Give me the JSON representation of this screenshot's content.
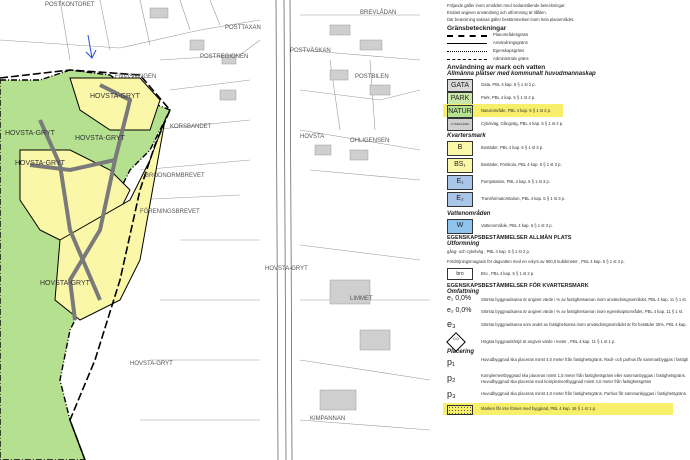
{
  "map": {
    "streets": [
      "POSTKONTORET",
      "POSTTAXAN",
      "BREVLÅDAN",
      "POSTVÄSKAN",
      "POSTREGIONEN",
      "POSTBILEN",
      "ENVISNINGEN",
      "KORSBANDET",
      "OHLIGENSEN",
      "BRÖDNORMBREVET",
      "FÖRENINGSBREVET",
      "HOVSTA-GRYT",
      "HOVSTA",
      "LIMMET",
      "KIMPANNAN",
      "HOVSTA-GRYT"
    ],
    "area_labels": [
      "HOVSTA-GRYT",
      "HOVSTA-GRYT",
      "HOVSTA-GRYT",
      "HOVSTA-GRYT",
      "HOVSTA-GRYT"
    ],
    "colors": {
      "natur": "#b5e08f",
      "bostad": "#fbf7a8",
      "gata": "#d9d9d9",
      "border": "#000000"
    }
  },
  "legend": {
    "intro": [
      "Följande gäller inom områden med nedanstående beteckningar.",
      "Endast angiven användning och utformning är tillåten.",
      "Där beteckning saknas gäller bestämmelsen inom hela planområdet."
    ],
    "boundaries_title": "Gränsbeteckningar",
    "boundaries": [
      "Planområdesgräns",
      "Användningsgräns",
      "Egenskapsgräns",
      "Administrativ gräns"
    ],
    "land_water_title": "Användning av mark och vatten",
    "public_title": "Allmänna platser med kommunalt huvudmannaskap",
    "public": [
      {
        "code": "GATA",
        "text": "Gata, PBL 4 kap. 5 § 1 st 2 p."
      },
      {
        "code": "PARK",
        "text": "Park, PBL 4 kap. 5 § 1 st 2 p."
      },
      {
        "code": "NATUR",
        "text": "Naturområde, PBL 4 kap. 5 § 1 st 2 p."
      },
      {
        "code": "CYKELGÅNG",
        "text": "Cykelväg, Gångväg, PBL 4 kap. 5 § 1 st 2 p."
      }
    ],
    "block_title": "Kvartersmark",
    "blocks": [
      {
        "code": "B",
        "text": "Bostäder, PBL 4 kap. 5 § 1 st 3 p."
      },
      {
        "code": "BS₁",
        "text": "Bostäder, Förskola, PBL 4 kap. 5 § 1 st 3 p."
      },
      {
        "code": "E₁",
        "text": "Pumpstation, PBL 4 kap. 5 § 1 st 3 p."
      },
      {
        "code": "E₂",
        "text": "Transformatorstation, PBL 4 kap. 5 § 1 st 3 p."
      }
    ],
    "water_title": "Vattenområden",
    "water": [
      {
        "code": "W",
        "text": "Vattenområde, PBL 4 kap. 5 § 1 st 3 p."
      }
    ],
    "props_public_title": "EGENSKAPSBESTÄMMELSER ALLMÄN PLATS",
    "design_title": "Utformning",
    "design": [
      {
        "code": "gång",
        "text": "gång- och cykelväg , PBL 4 kap. 5 § 1 st 2 p."
      },
      {
        "code": "fördröjning",
        "text": "Fördröjningsmagasin för dagvatten med en volym av 600,0 kubikmeter , PBL 4 kap. 5 § 1 st 2 p."
      },
      {
        "code": "bro",
        "text": "Bro , PBL 4 kap. 5 § 1 st 2 p."
      }
    ],
    "props_block_title": "EGENSKAPSBESTÄMMELSER FÖR KVARTERSMARK",
    "scope_title": "Omfattning",
    "scope": [
      {
        "code": "e₁ 0,0%",
        "text": "Största byggnadsarea är angivet värde i % av fastighetsarean inom användningsområdet, PBL 4 kap. 11 § 1 st."
      },
      {
        "code": "e₂ 0,0%",
        "text": "Största byggnadsarea är angivet värde i % av fastighetsarean inom egenskapsområdet, PBL 4 kap. 11 § 1 st."
      },
      {
        "code": "e₃",
        "text": "Största byggnadsarea som andel av fastighetsarea inom användningsområdet är för bostäder 25%, PBL 4 kap."
      },
      {
        "code": "0,0",
        "text": "Högsta byggnadshöjd är angivet värde i meter , PBL 4 kap. 11 § 1 st 1 p."
      }
    ],
    "placement_title": "Placering",
    "placement": [
      {
        "code": "p₁",
        "text": "Huvudbyggnad ska placeras minst 4,0 meter från fastighetsgräns. Radi- och parhus får sammanbyggas i fastigh"
      },
      {
        "code": "p₂",
        "text": "Komplementbyggnad ska placeras minst 1,5 meter från fastighetsgräns eller sammanbyggas i fastighetsgräns. Huvudbyggnad ska placeras med komplementbyggnad minst 4,0 meter från fastighetsgräns"
      },
      {
        "code": "p₃",
        "text": "Huvudbyggnad ska placeras minst 4,0 meter från fastighetsgräns. Parhus får sammanbyggas i fastighetsgräns."
      },
      {
        "code": "",
        "text": "Marken får inte förses med byggnad, PBL 4 kap. 16 § 1 st 1 p."
      }
    ]
  }
}
